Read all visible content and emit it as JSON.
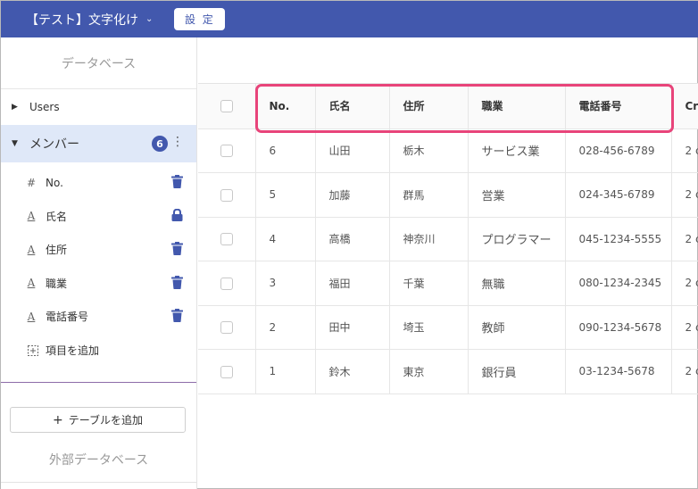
{
  "header": {
    "title": "【テスト】文字化け",
    "settings_label": "設 定"
  },
  "sidebar": {
    "heading": "データベース",
    "tables": [
      {
        "label": "Users",
        "expanded": false
      },
      {
        "label": "メンバー",
        "expanded": true,
        "count": "6"
      }
    ],
    "fields": [
      {
        "icon": "#",
        "label": "No.",
        "action": "trash"
      },
      {
        "icon": "A",
        "label": "氏名",
        "action": "lock"
      },
      {
        "icon": "A",
        "label": "住所",
        "action": "trash"
      },
      {
        "icon": "A",
        "label": "職業",
        "action": "trash"
      },
      {
        "icon": "A",
        "label": "電話番号",
        "action": "trash"
      }
    ],
    "add_field_label": "項目を追加",
    "add_table_label": "テーブルを追加",
    "external_heading": "外部データベース"
  },
  "table": {
    "columns": [
      "No.",
      "氏名",
      "住所",
      "職業",
      "電話番号",
      "Cr"
    ],
    "rows": [
      {
        "no": "6",
        "name": "山田",
        "address": "栃木",
        "job": "サービス業",
        "phone": "028-456-6789",
        "created": "2 c"
      },
      {
        "no": "5",
        "name": "加藤",
        "address": "群馬",
        "job": "営業",
        "phone": "024-345-6789",
        "created": "2 c"
      },
      {
        "no": "4",
        "name": "高橋",
        "address": "神奈川",
        "job": "プログラマー",
        "phone": "045-1234-5555",
        "created": "2 c"
      },
      {
        "no": "3",
        "name": "福田",
        "address": "千葉",
        "job": "無職",
        "phone": "080-1234-2345",
        "created": "2 c"
      },
      {
        "no": "2",
        "name": "田中",
        "address": "埼玉",
        "job": "教師",
        "phone": "090-1234-5678",
        "created": "2 c"
      },
      {
        "no": "1",
        "name": "鈴木",
        "address": "東京",
        "job": "銀行員",
        "phone": "03-1234-5678",
        "created": "2 c"
      }
    ]
  },
  "colors": {
    "header_bg": "#4258ad",
    "highlight": "#e8447a",
    "active_row_bg": "#dfe8f8"
  }
}
